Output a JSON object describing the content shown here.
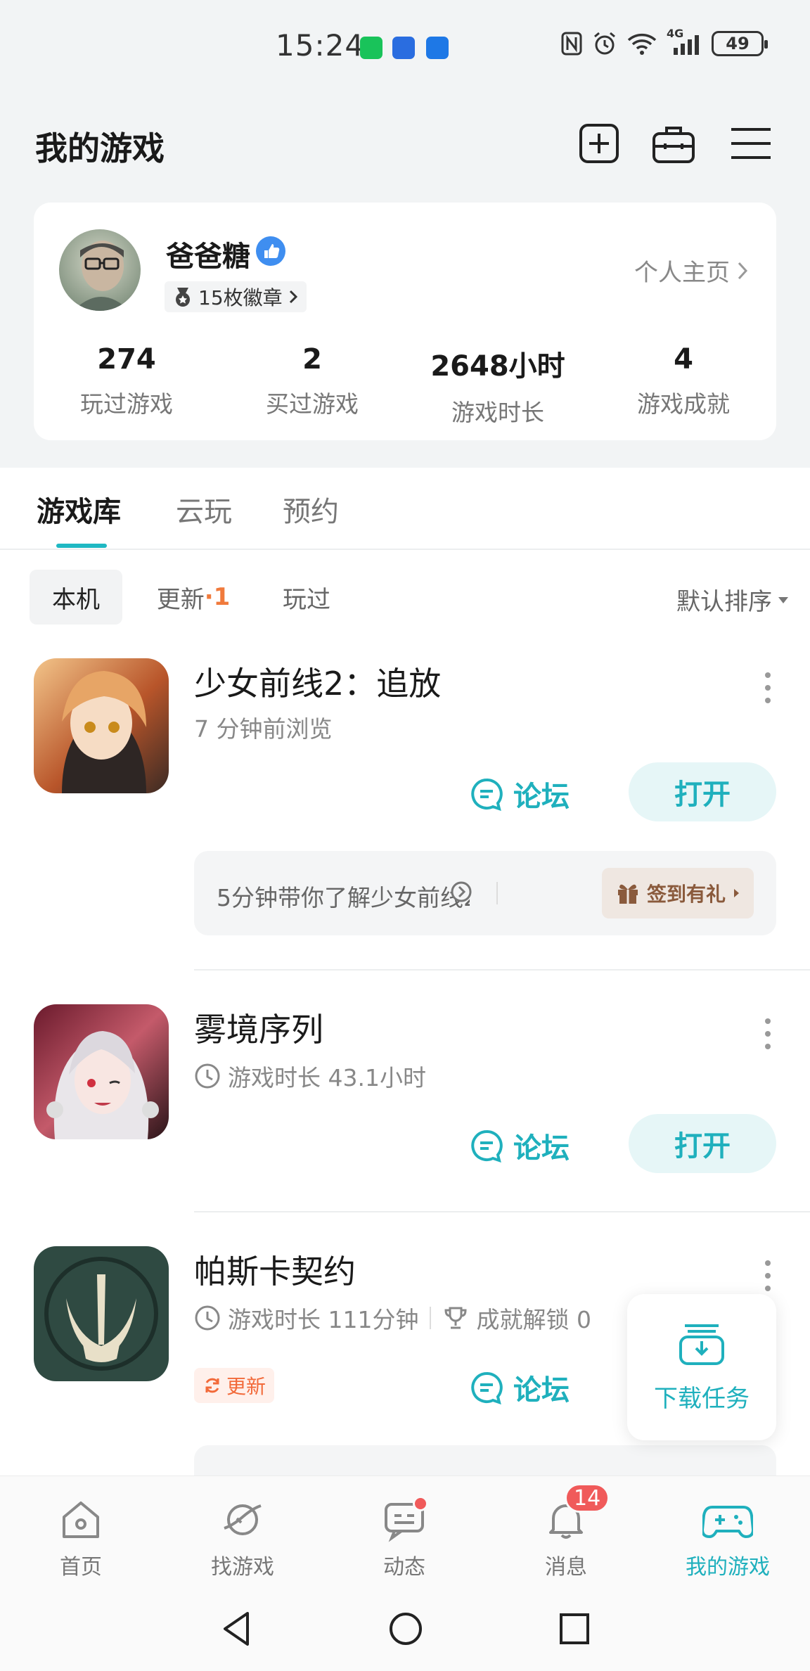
{
  "status_bar": {
    "time": "15:24",
    "network": "4G",
    "battery": "49"
  },
  "header": {
    "title": "我的游戏"
  },
  "profile": {
    "username": "爸爸糖",
    "badges": "15枚徽章",
    "homepage_link": "个人主页",
    "stats": [
      {
        "value": "274",
        "label": "玩过游戏"
      },
      {
        "value": "2",
        "label": "买过游戏"
      },
      {
        "value": "2648小时",
        "label": "游戏时长"
      },
      {
        "value": "4",
        "label": "游戏成就"
      }
    ]
  },
  "tabs": [
    {
      "label": "游戏库",
      "active": true
    },
    {
      "label": "云玩",
      "active": false
    },
    {
      "label": "预约",
      "active": false
    }
  ],
  "sub_tabs": {
    "local": "本机",
    "update": "更新",
    "update_count": "1",
    "played": "玩过",
    "sort": "默认排序"
  },
  "games": [
    {
      "title": "少女前线2：追放",
      "subtitle": "7 分钟前浏览",
      "forum": "论坛",
      "open": "打开",
      "promo_text": "5分钟带你了解少女前线2",
      "gift": "签到有礼"
    },
    {
      "title": "雾境序列",
      "subtitle": "游戏时长 43.1小时",
      "forum": "论坛",
      "open": "打开"
    },
    {
      "title": "帕斯卡契约",
      "subtitle": "游戏时长 111分钟",
      "achievement": "成就解锁 0",
      "forum": "论坛",
      "update_tag": "更新"
    }
  ],
  "download_task": "下载任务",
  "bottom_nav": [
    {
      "label": "首页",
      "icon": "home-icon"
    },
    {
      "label": "找游戏",
      "icon": "planet-icon"
    },
    {
      "label": "动态",
      "icon": "chat-icon"
    },
    {
      "label": "消息",
      "icon": "bell-icon",
      "badge": "14"
    },
    {
      "label": "我的游戏",
      "icon": "gamepad-icon",
      "active": true
    }
  ],
  "colors": {
    "accent": "#1fb0bd",
    "update_orange": "#f07a3c",
    "badge_red": "#f05a5a"
  }
}
